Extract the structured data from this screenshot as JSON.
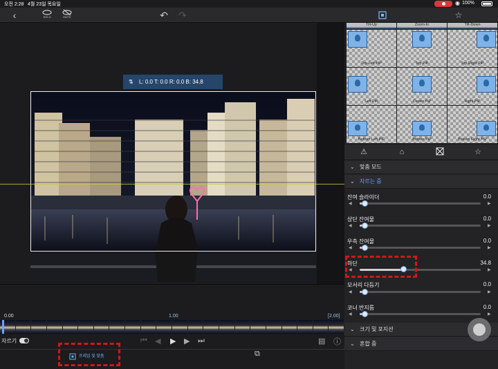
{
  "status_bar": {
    "time": "오전 2:28",
    "date": "4월 23일 목요일",
    "battery": "100%"
  },
  "toolbar": {
    "back": "‹",
    "tool_a": "SOLO",
    "tool_b": "MUTE",
    "undo": "↶",
    "redo": "↷",
    "panel_icon": "crop-icon",
    "star_icon": "star-icon"
  },
  "preview": {
    "crop_readout": "L:  0.0  T:  0.0  R:  0.0  B:  34.8",
    "crop_readout_icon": "⇅"
  },
  "timeline": {
    "start_time": "0.00",
    "mid_time": "1.00",
    "end_time": "[2.00]"
  },
  "transport": {
    "trim_label": "자르기"
  },
  "bottom_tabs": [
    {
      "label": "프레임 및 맞춤",
      "icon": "crop-frame-icon"
    },
    {
      "label": "",
      "icon": "transform-icon"
    }
  ],
  "pip_grid": {
    "top_row": [
      "Tilt-Up",
      "Zoom-In",
      "Tilt-Down"
    ],
    "cells": [
      "Top Left PiP",
      "Top PiP",
      "Top Right PiP",
      "Left PiP",
      "Center PiP",
      "Right PiP",
      "Bottom Left PiP",
      "Bottom PiP",
      "Bottom Right PiP"
    ]
  },
  "panel_tabs": [
    "warning-icon",
    "folder-icon",
    "crop-icon",
    "star-icon"
  ],
  "sections": {
    "fit_mode": "맞춤 모드",
    "crop": "자르는 중",
    "size_position": "크기 및 포지션",
    "blending": "혼합 중"
  },
  "sliders": [
    {
      "name": "잔여 슬라이더",
      "value": "0.0",
      "level": 0.0
    },
    {
      "name": "상단 잔여물",
      "value": "0.0",
      "level": 0.0
    },
    {
      "name": "우측 잔여물",
      "value": "0.0",
      "level": 0.0
    },
    {
      "name": "하단",
      "value": "34.8",
      "level": 0.348
    },
    {
      "name": "모서리 다듬기",
      "value": "0.0",
      "level": 0.0
    },
    {
      "name": "코너 반지름",
      "value": "0.0",
      "level": 0.0
    }
  ],
  "colors": {
    "accent": "#5aa2ff",
    "highlight": "#d01818"
  }
}
